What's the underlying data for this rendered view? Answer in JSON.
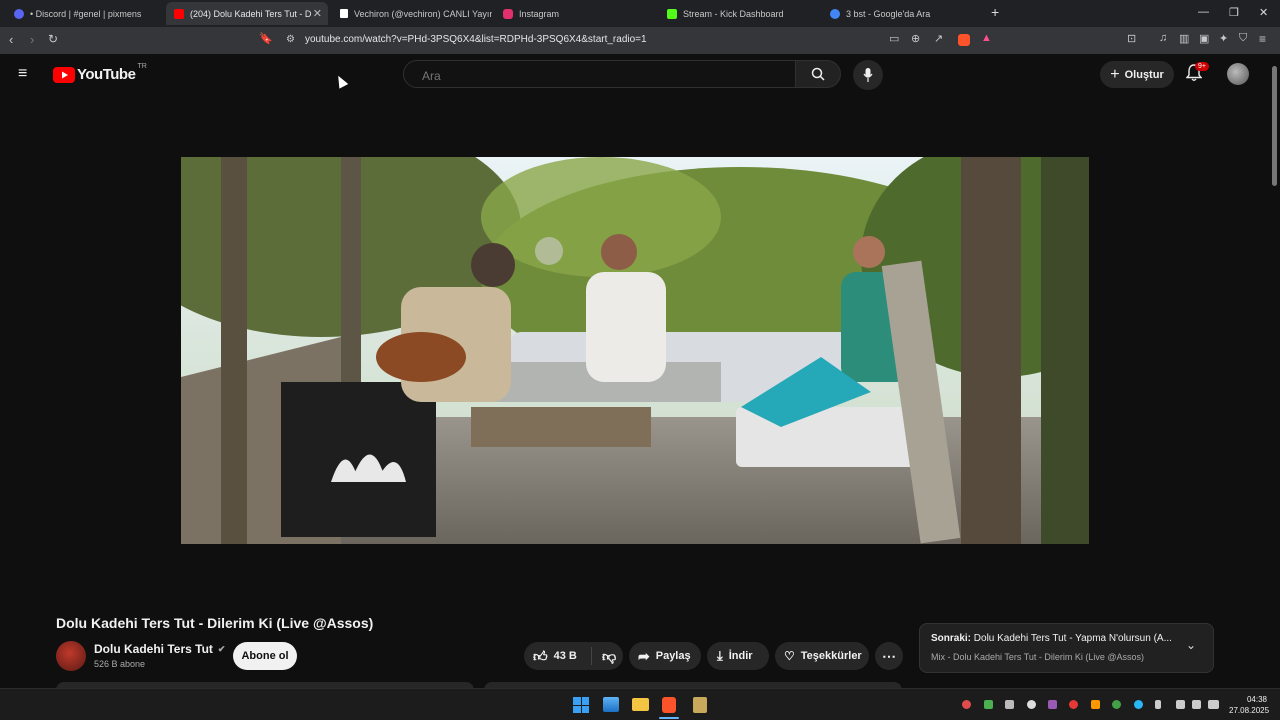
{
  "browser": {
    "tabs": [
      {
        "label": "• Discord | #genel | pixmens",
        "color": "#5865f2"
      },
      {
        "label": "(204) Dolu Kadehi Ters Tut - D",
        "color": "#ff0000",
        "active": true
      },
      {
        "label": "Vechiron (@vechiron) CANLI Yayında",
        "color": "#ffffff"
      },
      {
        "label": "Instagram",
        "color": "#e1306c"
      },
      {
        "label": "Stream - Kick Dashboard",
        "color": "#53fc18"
      },
      {
        "label": "3 bst - Google'da Ara",
        "color": "#4285f4"
      }
    ],
    "new_tab_icon": "plus-icon",
    "url": "youtube.com/watch?v=PHd-3PSQ6X4&list=RDPHd-3PSQ6X4&start_radio=1"
  },
  "youtube": {
    "logo_text": "YouTube",
    "region": "TR",
    "search_placeholder": "Ara",
    "create_label": "Oluştur",
    "notification_count": "9+"
  },
  "video": {
    "title": "Dolu Kadehi Ters Tut - Dilerim Ki (Live @Assos)",
    "channel": "Dolu Kadehi Ters Tut",
    "subscribers": "526 B abone",
    "subscribe_label": "Abone ol",
    "likes": "43 B",
    "share_label": "Paylaş",
    "download_label": "İndir",
    "thanks_label": "Teşekkürler"
  },
  "up_next": {
    "prefix": "Sonraki:",
    "title": "Dolu Kadehi Ters Tut - Yapma N'olursun (A...",
    "mix": "Mix - Dolu Kadehi Ters Tut - Dilerim Ki (Live @Assos)"
  },
  "taskbar": {
    "time": "04:38",
    "date": "27.08.2025"
  },
  "colors": {
    "youtube_red": "#ff0000",
    "background": "#0f0f0f"
  }
}
